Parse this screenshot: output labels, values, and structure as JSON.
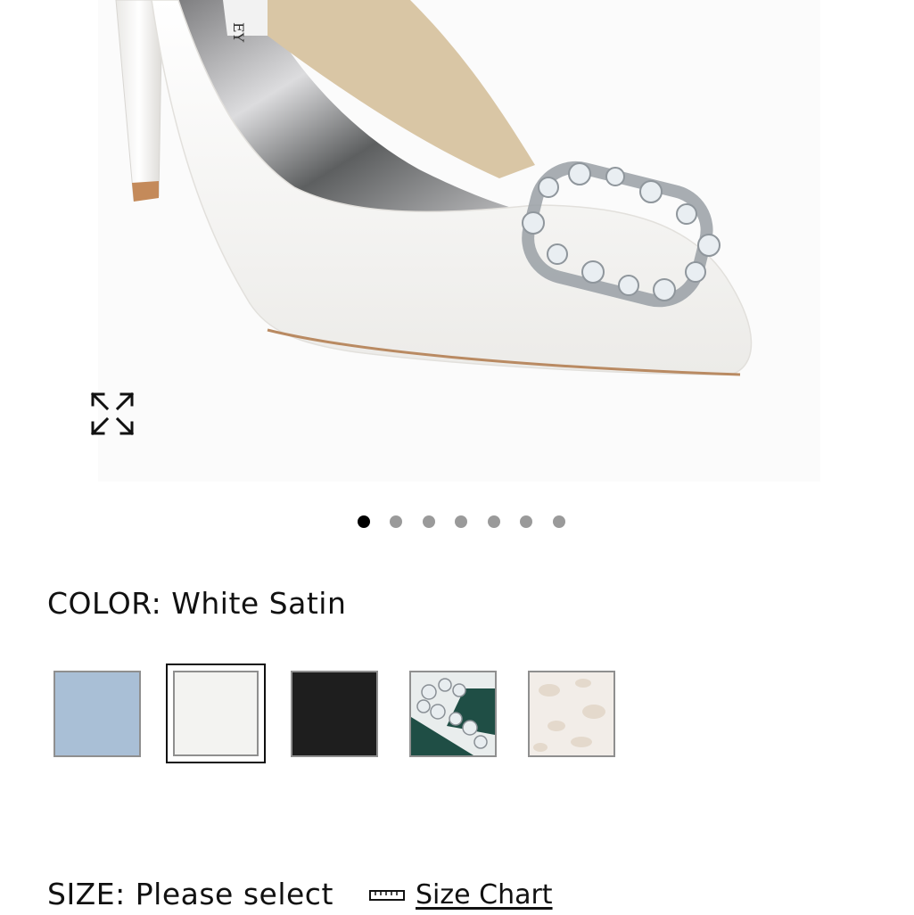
{
  "product": {
    "image_icon": "product-photo",
    "expand_icon": "expand-arrows-icon",
    "carousel": {
      "total": 7,
      "active_index": 0
    }
  },
  "color": {
    "label": "COLOR:",
    "value": "White Satin",
    "swatches": [
      {
        "name": "light-blue-satin",
        "color": "#a9bfd6",
        "selected": false
      },
      {
        "name": "white-satin",
        "color": "#f3f3f1",
        "selected": true
      },
      {
        "name": "black-satin",
        "color": "#1e1e1e",
        "selected": false
      },
      {
        "name": "emerald-jeweled",
        "color": "#1f4e45",
        "selected": false
      },
      {
        "name": "ivory-floral-lace",
        "color": "#f2ede8",
        "selected": false
      }
    ]
  },
  "size": {
    "label": "SIZE:",
    "value": "Please select",
    "chart_link": "Size Chart",
    "chart_icon": "ruler-icon"
  }
}
